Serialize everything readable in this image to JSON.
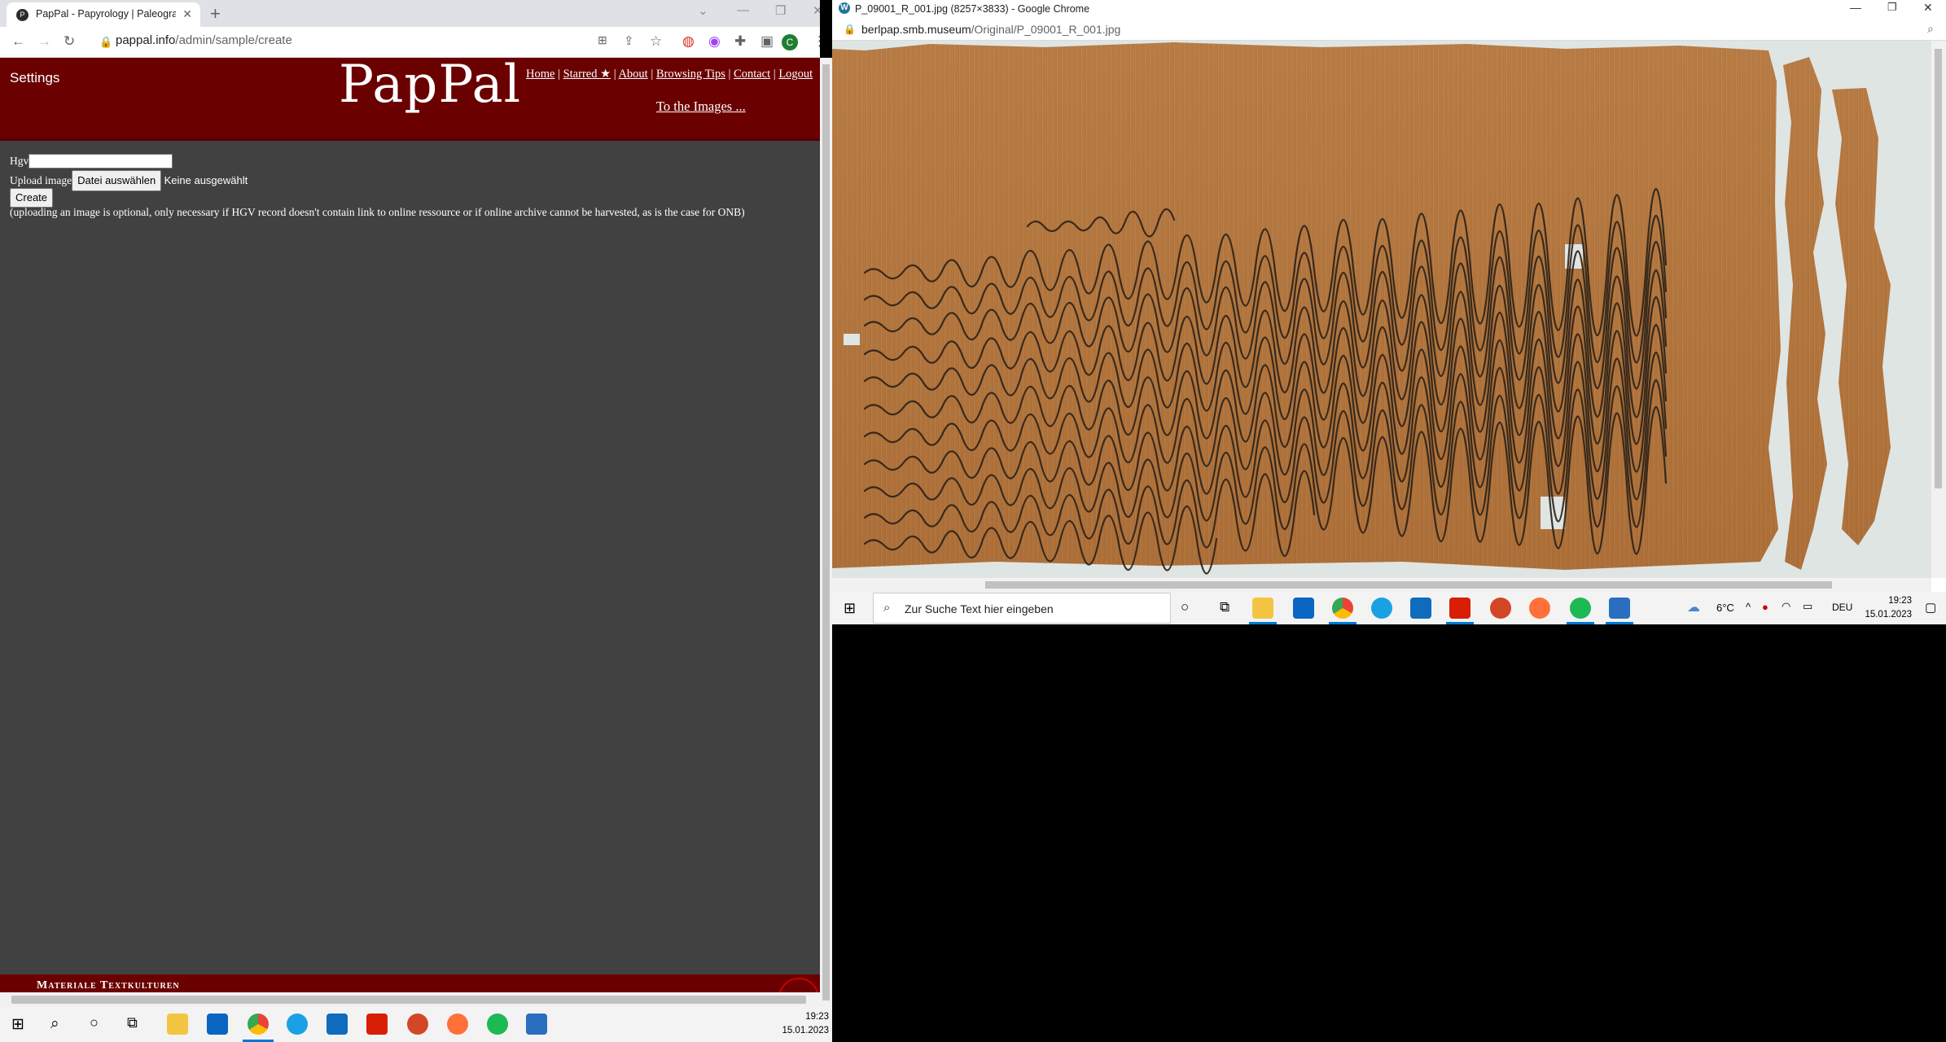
{
  "left_browser": {
    "tab_title": "PapPal - Papyrology | Paleograph",
    "tab_favicon": "P",
    "url_domain": "pappal.info",
    "url_path": "/admin/sample/create",
    "profile_initial": "C"
  },
  "pappal": {
    "settings_label": "Settings",
    "logo": "PapPal",
    "nav": {
      "home": "Home",
      "starred": "Starred ★",
      "about": "About",
      "browsing_tips": "Browsing Tips",
      "contact": "Contact",
      "logout": "Logout",
      "separator": "|"
    },
    "to_images": "To the Images ...",
    "form": {
      "hgv_label": "Hgv",
      "hgv_value": "",
      "upload_label": "Upload image",
      "file_button": "Datei auswählen",
      "file_status": "Keine ausgewählt",
      "create_button": "Create",
      "note": "(uploading an image is optional, only necessary if HGV record doesn't contain link to online ressource or if online archive cannot be harvested, as is the case for ONB)"
    },
    "footer_text": "Materiale Textkulturen"
  },
  "right_browser": {
    "window_title": "P_09001_R_001.jpg (8257×3833) - Google Chrome",
    "url_domain": "berlpap.smb.museum",
    "url_path": "/Original/P_09001_R_001.jpg",
    "image_description_icon": "papyrus-image"
  },
  "right_taskbar": {
    "search_placeholder": "Zur Suche Text hier eingeben",
    "weather": "6°C",
    "language": "DEU",
    "time": "19:23",
    "date": "15.01.2023"
  },
  "left_taskbar": {
    "time": "19:23",
    "date": "15.01.2023"
  },
  "colors": {
    "pappal_header": "#6a0000",
    "pappal_body": "#414141",
    "papyrus": "#b77a45"
  }
}
